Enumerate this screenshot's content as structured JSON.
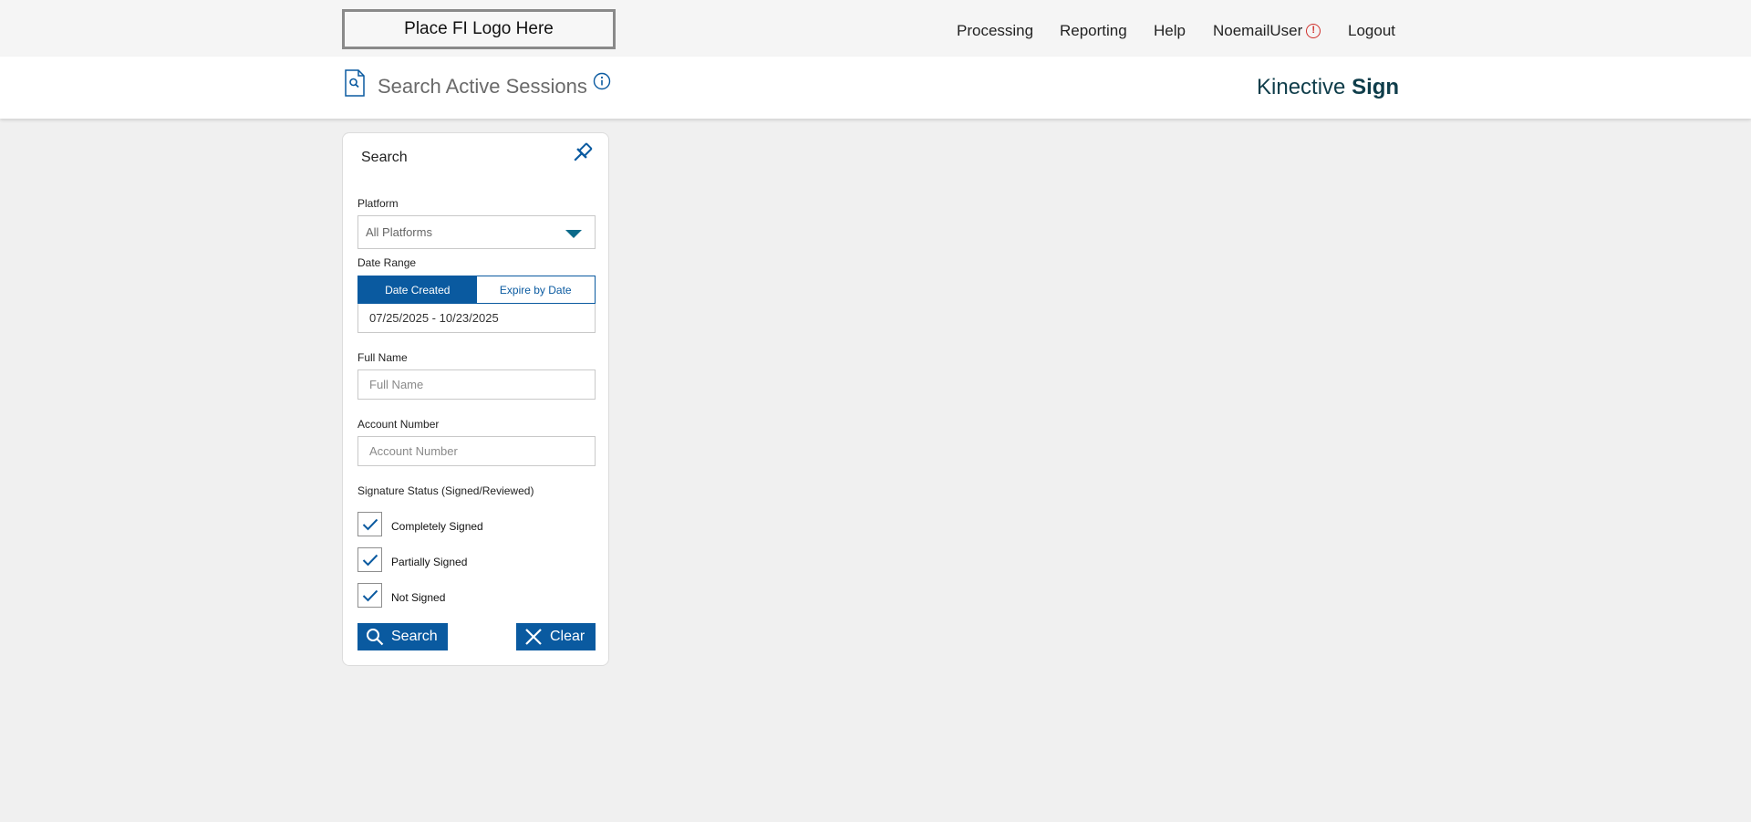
{
  "topbar": {
    "logo_text": "Place FI Logo Here",
    "nav": {
      "processing": "Processing",
      "reporting": "Reporting",
      "help": "Help",
      "user": "NoemailUser",
      "logout": "Logout"
    },
    "alert_glyph": "!"
  },
  "header": {
    "title": "Search Active Sessions",
    "brand_light": "Kinective ",
    "brand_bold": "Sign"
  },
  "search_panel": {
    "title": "Search",
    "platform": {
      "label": "Platform",
      "selected": "All Platforms"
    },
    "date_range": {
      "label": "Date Range",
      "tabs": [
        "Date Created",
        "Expire by Date"
      ],
      "active_tab": "Date Created",
      "value": "07/25/2025 - 10/23/2025"
    },
    "full_name": {
      "label": "Full Name",
      "placeholder": "Full Name"
    },
    "account_number": {
      "label": "Account Number",
      "placeholder": "Account Number"
    },
    "signature_status": {
      "label": "Signature Status (Signed/Reviewed)",
      "options": [
        {
          "label": "Completely Signed",
          "checked": true
        },
        {
          "label": "Partially Signed",
          "checked": true
        },
        {
          "label": "Not Signed",
          "checked": true
        }
      ]
    },
    "search_button": "Search",
    "clear_button": "Clear"
  },
  "colors": {
    "primary_blue": "#0a5aa0",
    "teal_caret": "#0b6a8a",
    "alert_red": "#d0312d",
    "brand_text": "#0f3d4a"
  }
}
